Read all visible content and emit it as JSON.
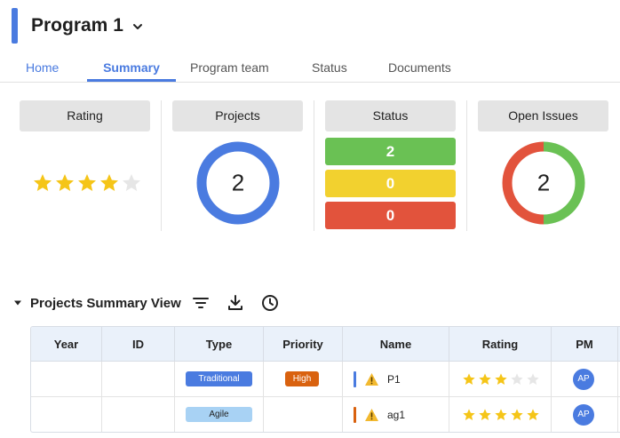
{
  "header": {
    "title": "Program 1"
  },
  "tabs": [
    "Home",
    "Summary",
    "Program team",
    "Status",
    "Documents"
  ],
  "cards": {
    "rating": {
      "label": "Rating",
      "stars": 4,
      "max": 5
    },
    "projects": {
      "label": "Projects",
      "value": "2"
    },
    "status": {
      "label": "Status",
      "green": "2",
      "yellow": "0",
      "red": "0"
    },
    "open_issues": {
      "label": "Open Issues",
      "value": "2"
    }
  },
  "section": {
    "title": "Projects Summary View"
  },
  "table": {
    "columns": [
      "Year",
      "ID",
      "Type",
      "Priority",
      "Name",
      "Rating",
      "PM"
    ],
    "rows": [
      {
        "year": "",
        "id": "",
        "type": "Traditional",
        "priority": "High",
        "name": "P1",
        "rating": 3,
        "pm": "AP"
      },
      {
        "year": "",
        "id": "",
        "type": "Agile",
        "priority": "",
        "name": "ag1",
        "rating": 5,
        "pm": "AP"
      }
    ]
  },
  "colors": {
    "accent": "#4a7be0",
    "green": "#6ac154",
    "yellow": "#f2d12f",
    "red": "#e2533c",
    "star": "#f5c518",
    "star_empty": "#e6e6e6"
  }
}
